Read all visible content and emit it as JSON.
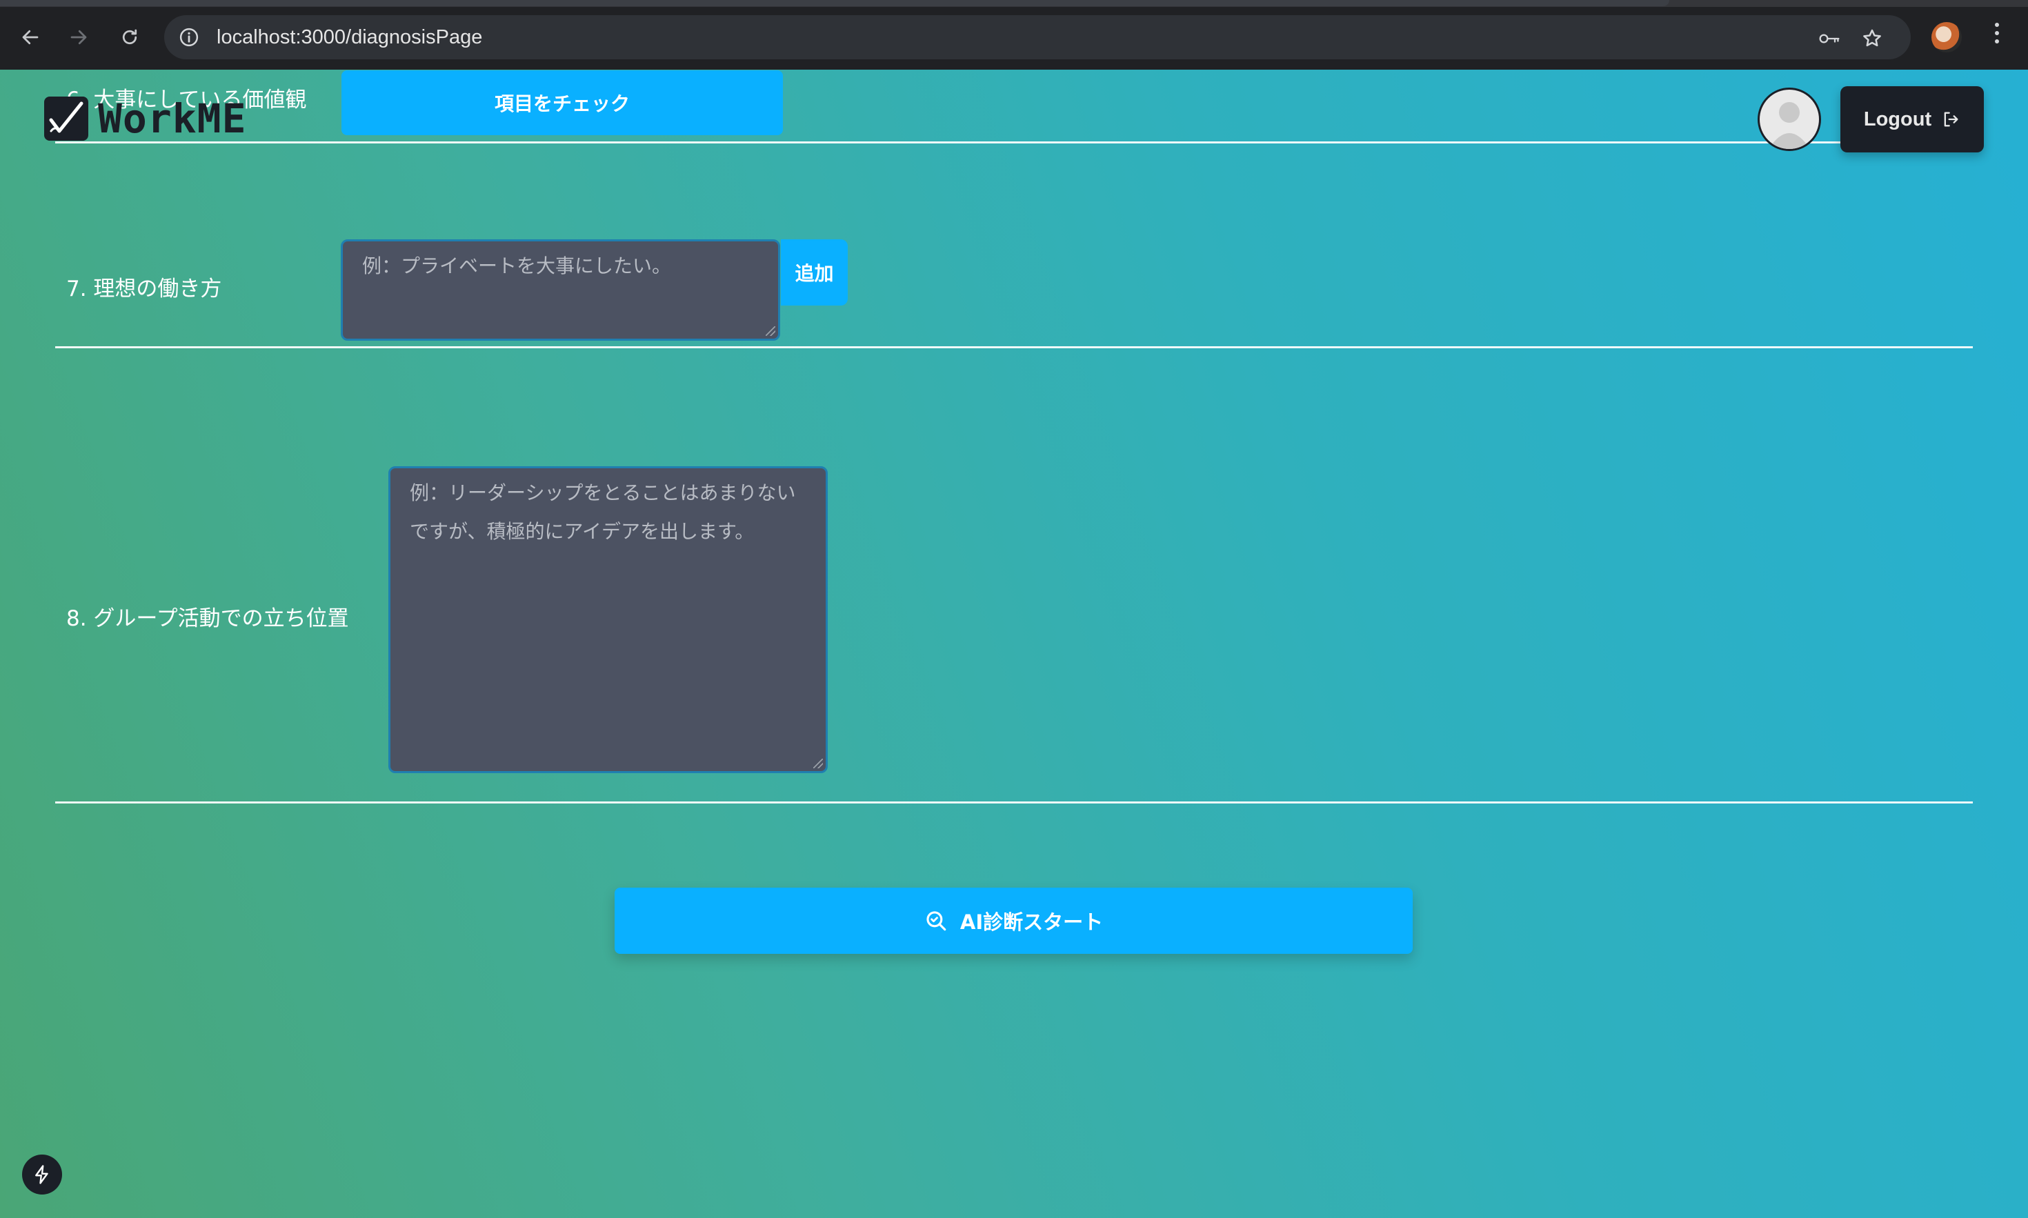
{
  "browser": {
    "url": "localhost:3000/diagnosisPage",
    "icons": [
      "back-arrow-icon",
      "forward-arrow-icon",
      "reload-icon",
      "site-info-icon",
      "password-key-icon",
      "bookmark-star-icon",
      "profile-avatar-icon",
      "menu-kebab-icon"
    ]
  },
  "header": {
    "logo_text": "WorkME",
    "logout_label": "Logout"
  },
  "form": {
    "q6": {
      "label": "6. 大事にしている価値観",
      "check_button": "項目をチェック"
    },
    "q7": {
      "label": "7. 理想の働き方",
      "placeholder": "例：プライベートを大事にしたい。",
      "add_button": "追加"
    },
    "q8": {
      "label": "8. グループ活動での立ち位置",
      "placeholder": "例：リーダーシップをとることはあまりないですが、積極的にアイデアを出します。"
    },
    "start_button": "AI診断スタート"
  },
  "colors": {
    "accent": "#0ab0ff",
    "dark": "#1b1f27",
    "textarea_bg": "#4c5262"
  }
}
